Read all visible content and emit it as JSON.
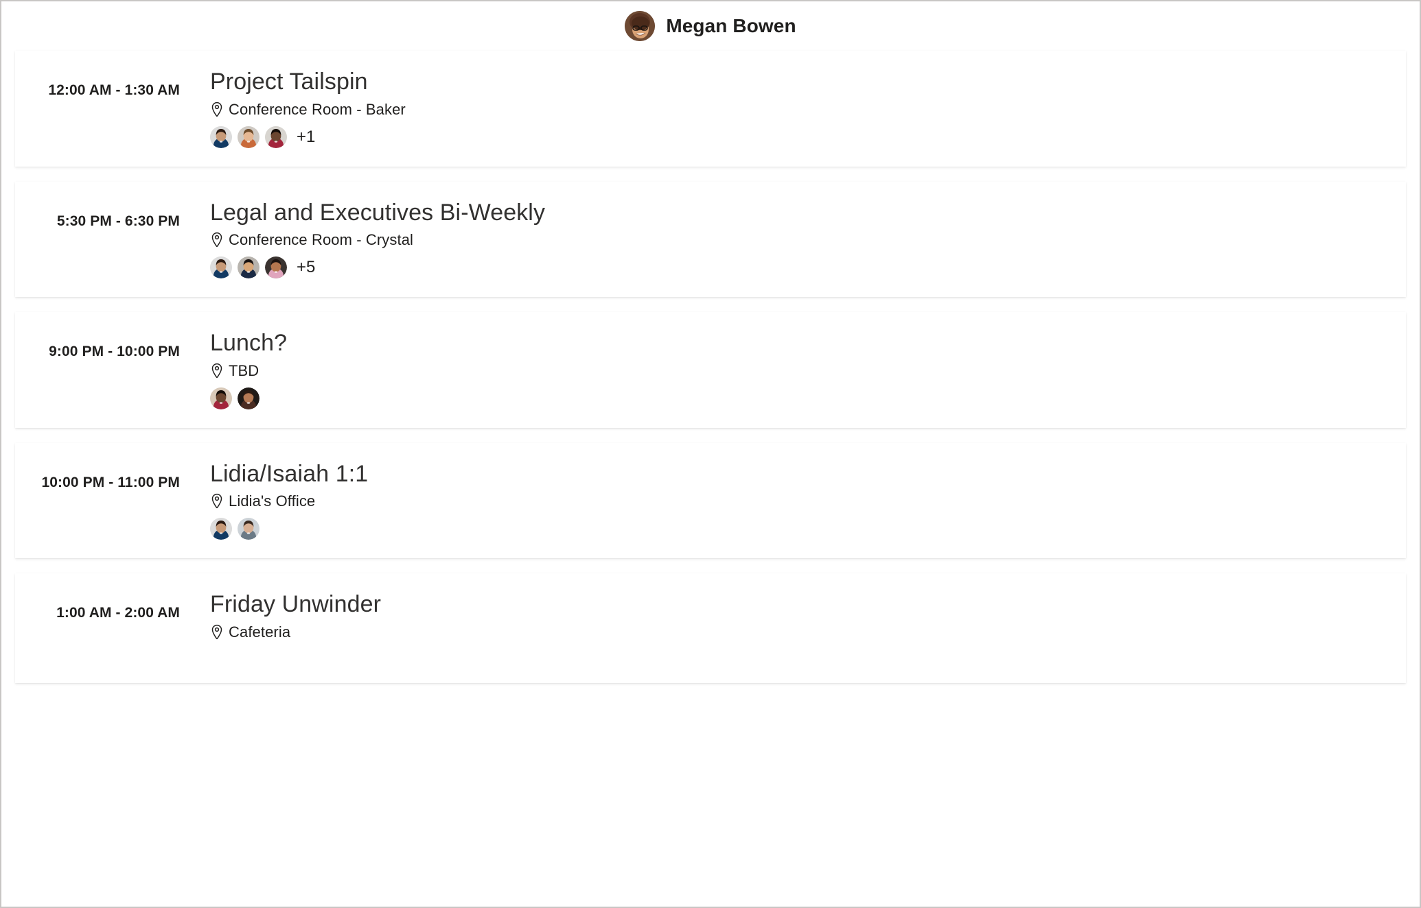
{
  "header": {
    "user_name": "Megan Bowen",
    "avatar_label": "megan-bowen-avatar"
  },
  "icons": {
    "location_pin": "location-pin-icon"
  },
  "events": [
    {
      "time": "12:00 AM - 1:30 AM",
      "subject": "Project Tailspin",
      "location": "Conference Room - Baker",
      "attendee_count": 3,
      "overflow": "+1",
      "avatar_colors": [
        "#123a63",
        "#c96a3a",
        "#a3253c"
      ],
      "avatar_skin": [
        "#c79a78",
        "#e6b894",
        "#6b4630"
      ],
      "avatar_hair": [
        "#2b1a12",
        "#6e4b2a",
        "#140d08"
      ],
      "avatar_bg": [
        "#dcdcdc",
        "#cfcac4",
        "#d8d5d0"
      ]
    },
    {
      "time": "5:30 PM - 6:30 PM",
      "subject": "Legal and Executives Bi-Weekly",
      "location": "Conference Room - Crystal",
      "attendee_count": 3,
      "overflow": "+5",
      "avatar_colors": [
        "#123a63",
        "#1b2a44",
        "#e0a5bd"
      ],
      "avatar_skin": [
        "#c79a78",
        "#d9a778",
        "#b5764f"
      ],
      "avatar_hair": [
        "#2b1a12",
        "#181210",
        "#1d1210"
      ],
      "avatar_bg": [
        "#dcdcdc",
        "#b8b4ae",
        "#3a3330"
      ]
    },
    {
      "time": "9:00 PM - 10:00 PM",
      "subject": "Lunch?",
      "location": "TBD",
      "attendee_count": 2,
      "overflow": "",
      "avatar_colors": [
        "#a3253c",
        "#4a2c22"
      ],
      "avatar_skin": [
        "#6b4630",
        "#b57a55"
      ],
      "avatar_hair": [
        "#140d08",
        "#2a1a12"
      ],
      "avatar_bg": [
        "#d8c9b8",
        "#1f1a17"
      ]
    },
    {
      "time": "10:00 PM - 11:00 PM",
      "subject": "Lidia/Isaiah 1:1",
      "location": "Lidia's Office",
      "attendee_count": 2,
      "overflow": "",
      "avatar_colors": [
        "#123a63",
        "#6b7a86"
      ],
      "avatar_skin": [
        "#c79a78",
        "#d8b094"
      ],
      "avatar_hair": [
        "#2b1a12",
        "#3a2a20"
      ],
      "avatar_bg": [
        "#dcdcdc",
        "#cdd3d8"
      ]
    },
    {
      "time": "1:00 AM - 2:00 AM",
      "subject": "Friday Unwinder",
      "location": "Cafeteria",
      "attendee_count": 0,
      "overflow": "",
      "avatar_colors": [],
      "avatar_skin": [],
      "avatar_hair": [],
      "avatar_bg": []
    }
  ],
  "colors": {
    "text_primary": "#201f1e",
    "text_subject": "#323130",
    "card_background": "#ffffff",
    "page_background": "#ffffff",
    "frame_border": "#c8c6c4"
  }
}
